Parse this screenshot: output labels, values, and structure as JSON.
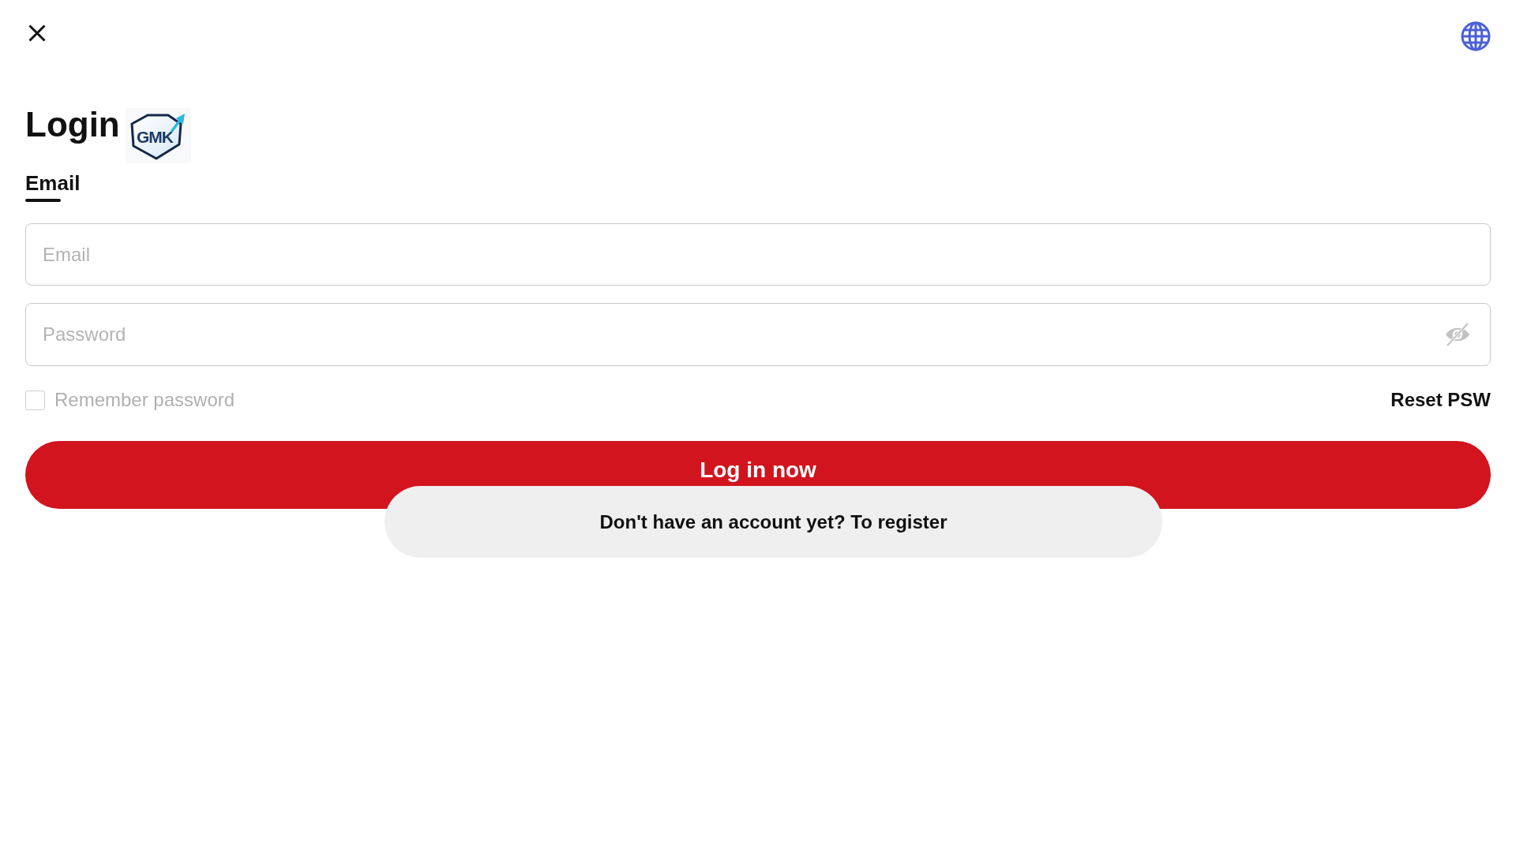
{
  "title": "Login",
  "logo": {
    "text": "GMK"
  },
  "tabs": [
    {
      "label": "Email",
      "selected": true
    }
  ],
  "fields": [
    {
      "kind": "email",
      "placeholder": "Email"
    },
    {
      "kind": "password",
      "placeholder": "Password",
      "revealed": false
    }
  ],
  "remember": {
    "label": "Remember password",
    "checked": false
  },
  "reset_link": "Reset PSW",
  "submit_button": "Log in now",
  "register_button": "Don't have an account yet? To register"
}
